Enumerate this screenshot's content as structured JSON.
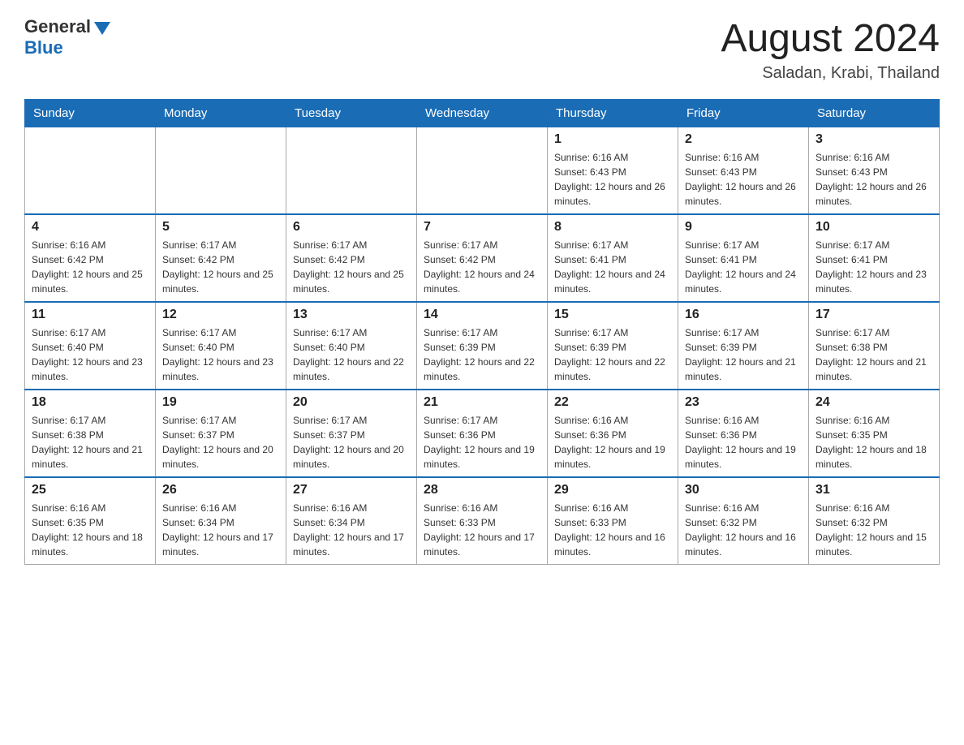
{
  "header": {
    "logo_general": "General",
    "logo_blue": "Blue",
    "month_title": "August 2024",
    "location": "Saladan, Krabi, Thailand"
  },
  "weekdays": [
    "Sunday",
    "Monday",
    "Tuesday",
    "Wednesday",
    "Thursday",
    "Friday",
    "Saturday"
  ],
  "weeks": [
    [
      {
        "day": "",
        "info": ""
      },
      {
        "day": "",
        "info": ""
      },
      {
        "day": "",
        "info": ""
      },
      {
        "day": "",
        "info": ""
      },
      {
        "day": "1",
        "info": "Sunrise: 6:16 AM\nSunset: 6:43 PM\nDaylight: 12 hours and 26 minutes."
      },
      {
        "day": "2",
        "info": "Sunrise: 6:16 AM\nSunset: 6:43 PM\nDaylight: 12 hours and 26 minutes."
      },
      {
        "day": "3",
        "info": "Sunrise: 6:16 AM\nSunset: 6:43 PM\nDaylight: 12 hours and 26 minutes."
      }
    ],
    [
      {
        "day": "4",
        "info": "Sunrise: 6:16 AM\nSunset: 6:42 PM\nDaylight: 12 hours and 25 minutes."
      },
      {
        "day": "5",
        "info": "Sunrise: 6:17 AM\nSunset: 6:42 PM\nDaylight: 12 hours and 25 minutes."
      },
      {
        "day": "6",
        "info": "Sunrise: 6:17 AM\nSunset: 6:42 PM\nDaylight: 12 hours and 25 minutes."
      },
      {
        "day": "7",
        "info": "Sunrise: 6:17 AM\nSunset: 6:42 PM\nDaylight: 12 hours and 24 minutes."
      },
      {
        "day": "8",
        "info": "Sunrise: 6:17 AM\nSunset: 6:41 PM\nDaylight: 12 hours and 24 minutes."
      },
      {
        "day": "9",
        "info": "Sunrise: 6:17 AM\nSunset: 6:41 PM\nDaylight: 12 hours and 24 minutes."
      },
      {
        "day": "10",
        "info": "Sunrise: 6:17 AM\nSunset: 6:41 PM\nDaylight: 12 hours and 23 minutes."
      }
    ],
    [
      {
        "day": "11",
        "info": "Sunrise: 6:17 AM\nSunset: 6:40 PM\nDaylight: 12 hours and 23 minutes."
      },
      {
        "day": "12",
        "info": "Sunrise: 6:17 AM\nSunset: 6:40 PM\nDaylight: 12 hours and 23 minutes."
      },
      {
        "day": "13",
        "info": "Sunrise: 6:17 AM\nSunset: 6:40 PM\nDaylight: 12 hours and 22 minutes."
      },
      {
        "day": "14",
        "info": "Sunrise: 6:17 AM\nSunset: 6:39 PM\nDaylight: 12 hours and 22 minutes."
      },
      {
        "day": "15",
        "info": "Sunrise: 6:17 AM\nSunset: 6:39 PM\nDaylight: 12 hours and 22 minutes."
      },
      {
        "day": "16",
        "info": "Sunrise: 6:17 AM\nSunset: 6:39 PM\nDaylight: 12 hours and 21 minutes."
      },
      {
        "day": "17",
        "info": "Sunrise: 6:17 AM\nSunset: 6:38 PM\nDaylight: 12 hours and 21 minutes."
      }
    ],
    [
      {
        "day": "18",
        "info": "Sunrise: 6:17 AM\nSunset: 6:38 PM\nDaylight: 12 hours and 21 minutes."
      },
      {
        "day": "19",
        "info": "Sunrise: 6:17 AM\nSunset: 6:37 PM\nDaylight: 12 hours and 20 minutes."
      },
      {
        "day": "20",
        "info": "Sunrise: 6:17 AM\nSunset: 6:37 PM\nDaylight: 12 hours and 20 minutes."
      },
      {
        "day": "21",
        "info": "Sunrise: 6:17 AM\nSunset: 6:36 PM\nDaylight: 12 hours and 19 minutes."
      },
      {
        "day": "22",
        "info": "Sunrise: 6:16 AM\nSunset: 6:36 PM\nDaylight: 12 hours and 19 minutes."
      },
      {
        "day": "23",
        "info": "Sunrise: 6:16 AM\nSunset: 6:36 PM\nDaylight: 12 hours and 19 minutes."
      },
      {
        "day": "24",
        "info": "Sunrise: 6:16 AM\nSunset: 6:35 PM\nDaylight: 12 hours and 18 minutes."
      }
    ],
    [
      {
        "day": "25",
        "info": "Sunrise: 6:16 AM\nSunset: 6:35 PM\nDaylight: 12 hours and 18 minutes."
      },
      {
        "day": "26",
        "info": "Sunrise: 6:16 AM\nSunset: 6:34 PM\nDaylight: 12 hours and 17 minutes."
      },
      {
        "day": "27",
        "info": "Sunrise: 6:16 AM\nSunset: 6:34 PM\nDaylight: 12 hours and 17 minutes."
      },
      {
        "day": "28",
        "info": "Sunrise: 6:16 AM\nSunset: 6:33 PM\nDaylight: 12 hours and 17 minutes."
      },
      {
        "day": "29",
        "info": "Sunrise: 6:16 AM\nSunset: 6:33 PM\nDaylight: 12 hours and 16 minutes."
      },
      {
        "day": "30",
        "info": "Sunrise: 6:16 AM\nSunset: 6:32 PM\nDaylight: 12 hours and 16 minutes."
      },
      {
        "day": "31",
        "info": "Sunrise: 6:16 AM\nSunset: 6:32 PM\nDaylight: 12 hours and 15 minutes."
      }
    ]
  ]
}
